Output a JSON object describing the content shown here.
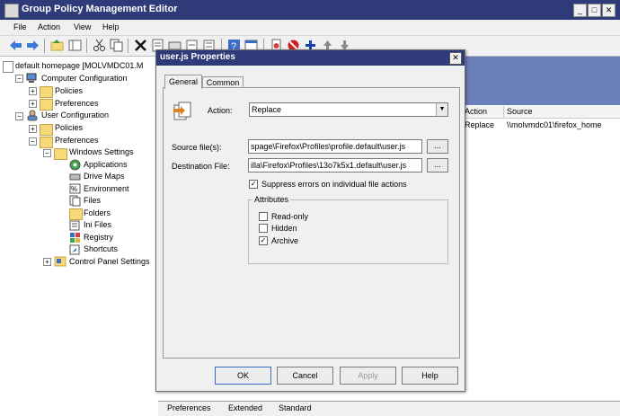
{
  "window": {
    "title": "Group Policy Management Editor",
    "min": "_",
    "max": "□",
    "close": "✕"
  },
  "menu": [
    "File",
    "Action",
    "View",
    "Help"
  ],
  "tree": {
    "root": "default homepage [MOLVMDC01.M",
    "computer_config": "Computer Configuration",
    "cc_policies": "Policies",
    "cc_preferences": "Preferences",
    "user_config": "User Configuration",
    "uc_policies": "Policies",
    "uc_preferences": "Preferences",
    "windows_settings": "Windows Settings",
    "applications": "Applications",
    "drive_maps": "Drive Maps",
    "environment": "Environment",
    "files": "Files",
    "folders": "Folders",
    "ini_files": "Ini Files",
    "registry": "Registry",
    "shortcuts": "Shortcuts",
    "control_panel": "Control Panel Settings"
  },
  "list": {
    "col_action": "Action",
    "col_source": "Source",
    "row_action": "Replace",
    "row_source": "\\\\molvmdc01\\firefox_home"
  },
  "bottom_tabs": [
    "Preferences",
    "Extended",
    "Standard"
  ],
  "dialog": {
    "title": "user.js Properties",
    "close": "✕",
    "tabs": [
      "General",
      "Common"
    ],
    "action_label": "Action:",
    "action_value": "Replace",
    "source_label": "Source file(s):",
    "source_value": "spage\\Firefox\\Profiles\\profile.default\\user.js",
    "dest_label": "Destination File:",
    "dest_value": "illa\\Firefox\\Profiles\\13o7k5x1.default\\user.js",
    "browse": "...",
    "suppress_label": "Suppress errors on individual file actions",
    "attributes_label": "Attributes",
    "readonly_label": "Read-only",
    "hidden_label": "Hidden",
    "archive_label": "Archive",
    "ok": "OK",
    "cancel": "Cancel",
    "apply": "Apply",
    "help": "Help"
  },
  "colors": {
    "titlebar": "#2f3a78",
    "panel": "#f0f0f0",
    "accent": "#6b7fb8"
  }
}
